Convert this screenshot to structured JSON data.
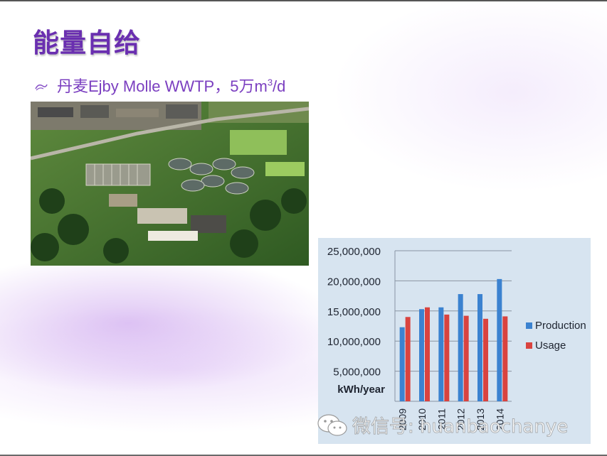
{
  "slide": {
    "title": "能量自给",
    "bullet_prefix": "丹麦Ejby Molle WWTP，5万m",
    "bullet_sup": "3",
    "bullet_suffix": "/d"
  },
  "photo": {
    "icon": "aerial-wastewater-plant-photo"
  },
  "chart_data": {
    "type": "bar",
    "categories": [
      "2009",
      "2010",
      "2011",
      "2012",
      "2013",
      "2014"
    ],
    "series": [
      {
        "name": "Production",
        "values": [
          12300000,
          15300000,
          15600000,
          17800000,
          17800000,
          20300000
        ],
        "color": "#3b82d0"
      },
      {
        "name": "Usage",
        "values": [
          14000000,
          15600000,
          14400000,
          14200000,
          13700000,
          14100000
        ],
        "color": "#d9433f"
      }
    ],
    "ylim": [
      0,
      25000000
    ],
    "yticks": [
      "25,000,000",
      "20,000,000",
      "15,000,000",
      "10,000,000",
      "5,000,000"
    ],
    "ytick_values": [
      25000000,
      20000000,
      15000000,
      10000000,
      5000000
    ],
    "ylabel": "kWh/year",
    "grid": true,
    "legend_position": "right"
  },
  "watermark": {
    "text": "微信号: huanbaochanye",
    "icon": "wechat-icon"
  }
}
